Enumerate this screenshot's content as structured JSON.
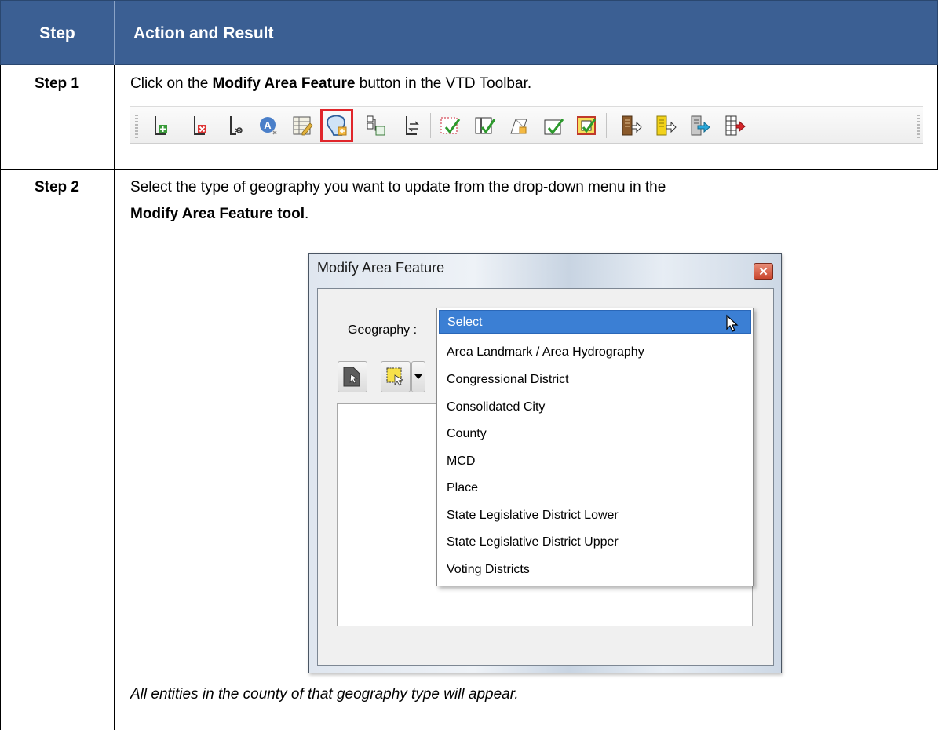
{
  "header": {
    "step_label": "Step",
    "action_label": "Action and Result"
  },
  "steps": [
    {
      "label": "Step 1",
      "text_before": "Click on the ",
      "text_bold": "Modify Area Feature",
      "text_after": " button in the VTD Toolbar."
    },
    {
      "label": "Step 2",
      "line1": "Select the type of geography you want to update from the drop-down menu in the",
      "line2_bold": "Modify Area Feature tool",
      "line2_after": ".",
      "note": "All entities in the county of that geography type will appear."
    }
  ],
  "toolbar": {
    "icons": [
      "add-line-icon",
      "delete-line-icon",
      "split-line-icon",
      "label-icon",
      "attribute-table-icon",
      "modify-area-feature-icon",
      "merge-icon",
      "flip-line-icon",
      "select-check-icon",
      "edit-check-icon",
      "shape-check-icon",
      "validate-check-icon",
      "review-check-icon",
      "export-brown-icon",
      "export-yellow-icon",
      "export-blue-icon",
      "export-red-icon"
    ],
    "highlighted_icon": "modify-area-feature-icon",
    "highlight_color": "#e0262b"
  },
  "dialog": {
    "title": "Modify Area Feature",
    "geography_label": "Geography :",
    "options": [
      "Select",
      "Area Landmark / Area Hydrography",
      "Congressional District",
      "Consolidated City",
      "County",
      "MCD",
      "Place",
      "State Legislative District Lower",
      "State Legislative District Upper",
      "Voting Districts"
    ],
    "selected_option": "Select",
    "selection_color": "#3b7fd4"
  },
  "colors": {
    "header_bg": "#3b5f93",
    "header_text": "#ffffff"
  }
}
